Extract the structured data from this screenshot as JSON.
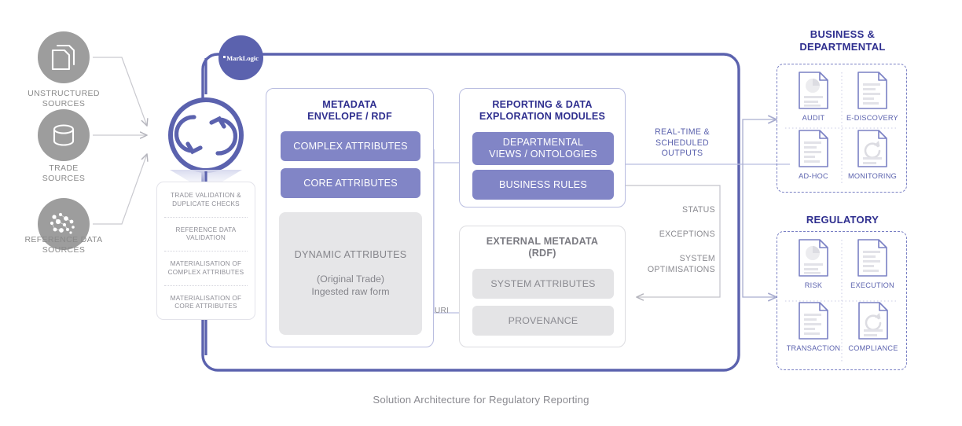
{
  "caption": "Solution Architecture for Regulatory Reporting",
  "sources": [
    {
      "label": "UNSTRUCTURED\nSOURCES",
      "icon": "documents-icon",
      "line1": "UNSTRUCTURED",
      "line2": "SOURCES"
    },
    {
      "label": "TRADE\nSOURCES",
      "icon": "database-icon",
      "line1": "TRADE",
      "line2": "SOURCES"
    },
    {
      "label": "REFERENCE DATA\nSOURCES",
      "icon": "data-points-icon",
      "line1": "REFERENCE DATA",
      "line2": "SOURCES"
    }
  ],
  "platform": {
    "badge_label": "MarkLogic",
    "badge_icon": "marklogic-logo-icon",
    "ingest_icon": "sync-refresh-icon"
  },
  "validation": {
    "items": [
      "TRADE VALIDATION &\nDUPLICATE CHECKS",
      "REFERENCE DATA\nVALIDATION",
      "MATERIALISATION OF\nCOMPLEX ATTRIBUTES",
      "MATERIALISATION OF\nCORE ATTRIBUTES"
    ]
  },
  "metadata_envelope": {
    "title_line1": "METADATA",
    "title_line2": "ENVELOPE / RDF",
    "pills": [
      "COMPLEX ATTRIBUTES",
      "CORE ATTRIBUTES"
    ],
    "dynamic": {
      "heading": "DYNAMIC ATTRIBUTES",
      "sub_line1": "(Original Trade)",
      "sub_line2": "Ingested raw form"
    }
  },
  "reporting_modules": {
    "title_line1": "REPORTING & DATA",
    "title_line2": "EXPLORATION MODULES",
    "pills": [
      "DEPARTMENTAL\nVIEWS / ONTOLOGIES",
      "BUSINESS RULES"
    ],
    "pill_lines": [
      [
        "DEPARTMENTAL",
        "VIEWS / ONTOLOGIES"
      ],
      [
        "BUSINESS RULES"
      ]
    ]
  },
  "external_metadata": {
    "title_line1": "EXTERNAL METADATA",
    "title_line2": "(RDF)",
    "pills": [
      "SYSTEM ATTRIBUTES",
      "PROVENANCE"
    ]
  },
  "connectors": {
    "uri_label": "URI",
    "outputs_line1": "REAL-TIME &",
    "outputs_line2": "SCHEDULED",
    "outputs_line3": "OUTPUTS",
    "feedback": [
      "STATUS",
      "EXCEPTIONS",
      "SYSTEM\nOPTIMISATIONS"
    ],
    "feedback_lines": [
      [
        "STATUS"
      ],
      [
        "EXCEPTIONS"
      ],
      [
        "SYSTEM",
        "OPTIMISATIONS"
      ]
    ]
  },
  "outputs": {
    "business": {
      "title_line1": "BUSINESS &",
      "title_line2": "DEPARTMENTAL",
      "cells": [
        {
          "label": "AUDIT",
          "icon": "doc-piechart-icon"
        },
        {
          "label": "E-DISCOVERY",
          "icon": "doc-text-icon"
        },
        {
          "label": "AD-HOC",
          "icon": "doc-text-icon"
        },
        {
          "label": "MONITORING",
          "icon": "doc-refresh-icon"
        }
      ]
    },
    "regulatory": {
      "title_line1": "REGULATORY",
      "title_line2": "",
      "cells": [
        {
          "label": "RISK",
          "icon": "doc-piechart-icon"
        },
        {
          "label": "EXECUTION",
          "icon": "doc-text-icon"
        },
        {
          "label": "TRANSACTION",
          "icon": "doc-text-icon"
        },
        {
          "label": "COMPLIANCE",
          "icon": "doc-refresh-icon"
        }
      ]
    }
  },
  "colors": {
    "primary_purple": "#5b62ae",
    "pill_purple": "#8185c6",
    "title_navy": "#2f2f8f",
    "gray_icon": "#9d9d9d",
    "gray_fill": "#e4e4e6",
    "gray_text": "#8a8a90",
    "border_light": "#b9bde0"
  }
}
